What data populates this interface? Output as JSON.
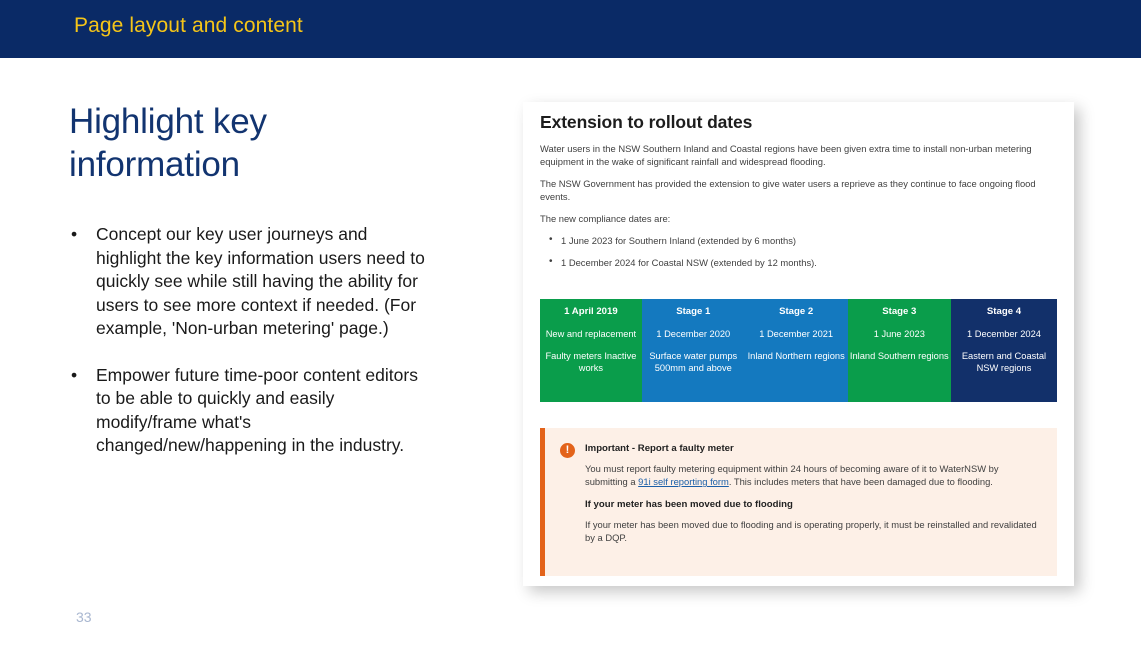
{
  "topbar": {
    "title": "Page layout and content",
    "bg_color": "#0a2a66",
    "text_color": "#f5c518"
  },
  "slide": {
    "heading": "Highlight key information",
    "heading_color": "#123470",
    "page_number": "33",
    "bullets": [
      "Concept our key user journeys and highlight the key information users need to quickly see while still having the ability for users to see more context if needed. (For example, 'Non-urban metering' page.)",
      "Empower future time-poor content editors to be able to quickly and easily modify/frame what's changed/new/happening in the industry."
    ],
    "bullet_marker": "•"
  },
  "screenshot": {
    "title": "Extension to rollout dates",
    "paragraphs": [
      "Water users in the NSW Southern Inland and Coastal regions have been given extra time to install non-urban metering equipment in the wake of significant rainfall and widespread flooding.",
      "The NSW Government has provided the extension to give water users a reprieve as they continue to face ongoing flood events.",
      "The new compliance dates are:"
    ],
    "compliance_dates": [
      "1 June 2023 for Southern Inland (extended by 6 months)",
      "1 December 2024 for Coastal NSW (extended by 12 months)."
    ],
    "stage_table": {
      "columns": [
        {
          "header": "1 April 2019",
          "lines": [
            "New and replacement",
            "Faulty meters Inactive works"
          ],
          "color": "#0a9d4b",
          "width_pct": 19.7
        },
        {
          "header": "Stage 1",
          "lines": [
            "1 December 2020",
            "Surface water pumps 500mm and above"
          ],
          "color": "#1479bf",
          "width_pct": 19.9
        },
        {
          "header": "Stage 2",
          "lines": [
            "1 December 2021",
            "Inland Northern regions"
          ],
          "color": "#1479bf",
          "width_pct": 19.9
        },
        {
          "header": "Stage 3",
          "lines": [
            "1 June 2023",
            "Inland Southern regions"
          ],
          "color": "#0a9d4b",
          "width_pct": 20.0
        },
        {
          "header": "Stage 4",
          "lines": [
            "1 December 2024",
            "Eastern and Coastal NSW regions"
          ],
          "color": "#12306a",
          "width_pct": 20.5
        }
      ]
    },
    "callout": {
      "icon_glyph": "!",
      "icon_color": "#e3631a",
      "bg_color": "#fdf0e7",
      "heading_1": "Important - Report a faulty meter",
      "body_1_before": "You must report faulty metering equipment within 24 hours of becoming aware of it to WaterNSW by submitting a ",
      "body_1_link": "91i self reporting form",
      "body_1_after": ". This includes meters that have been damaged due to flooding.",
      "heading_2": "If your meter has been moved due to flooding",
      "body_2": "If your meter has been moved due to flooding and is operating properly, it must be reinstalled and revalidated by a DQP."
    }
  }
}
